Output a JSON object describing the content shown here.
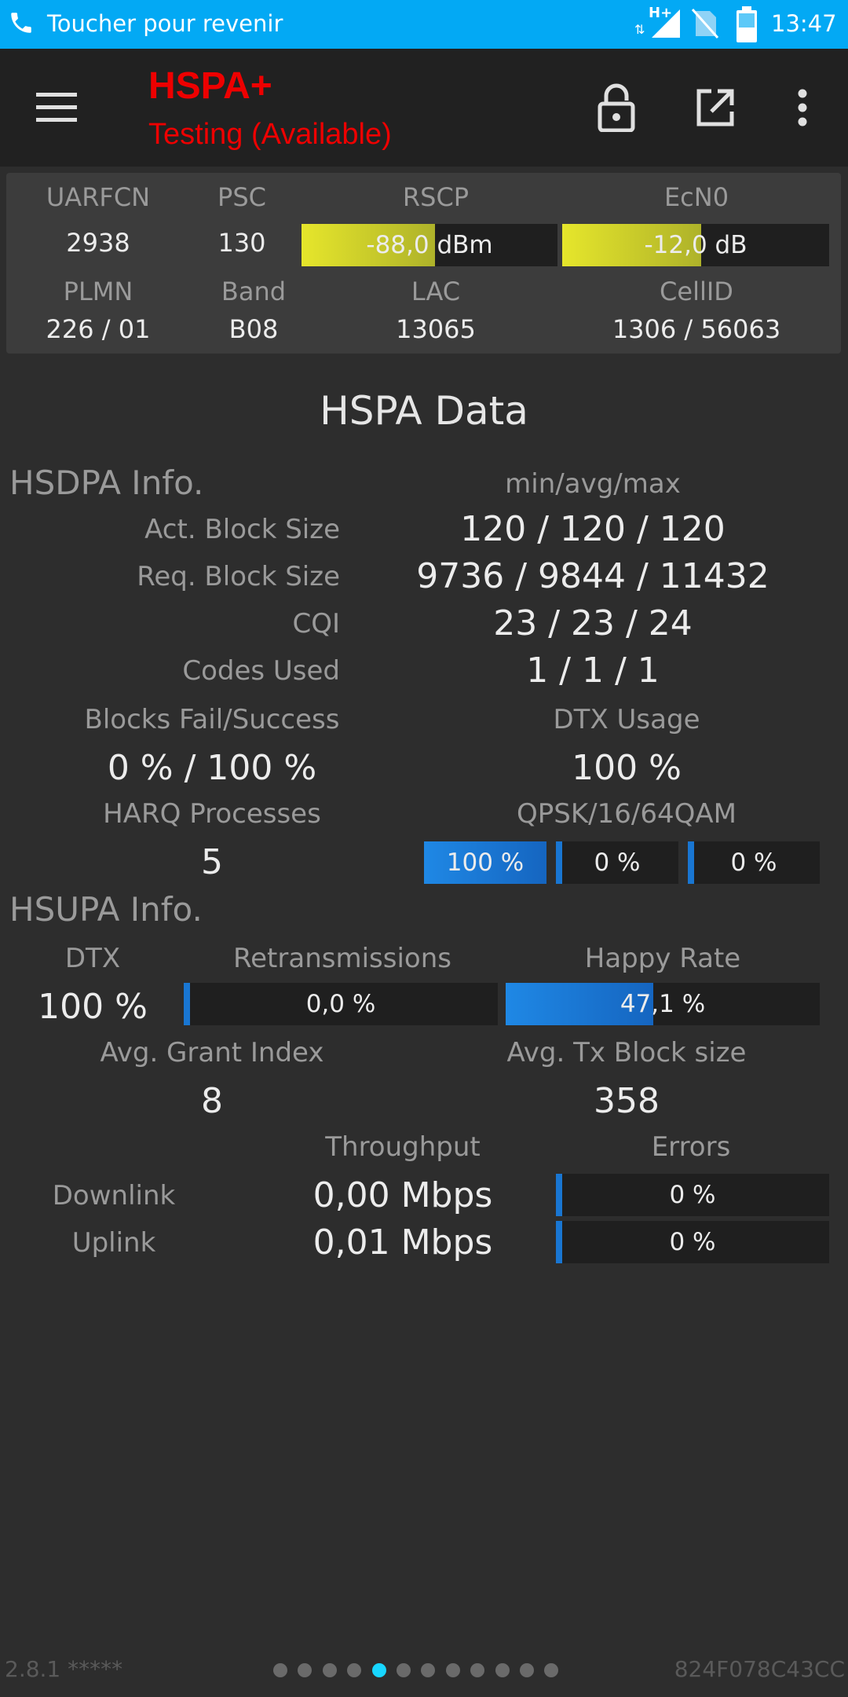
{
  "status_bar": {
    "notice": "Toucher pour revenir",
    "network_badge": "H+",
    "time": "13:47"
  },
  "toolbar": {
    "title": "HSPA+",
    "subtitle": "Testing (Available)",
    "icons": [
      "menu-icon",
      "lock-open-icon",
      "open-external-icon",
      "more-vert-icon"
    ]
  },
  "cell": {
    "labels": {
      "uarfcn": "UARFCN",
      "psc": "PSC",
      "rscp": "RSCP",
      "ecn0": "EcN0",
      "plmn": "PLMN",
      "band": "Band",
      "lac": "LAC",
      "cellid": "CellID"
    },
    "uarfcn": "2938",
    "psc": "130",
    "rscp": "-88,0 dBm",
    "rscp_level": 0.52,
    "ecn0": "-12,0 dB",
    "ecn0_level": 0.52,
    "plmn": "226 / 01",
    "band": "B08",
    "lac": "13065",
    "cellid": "1306 / 56063"
  },
  "section_title": "HSPA Data",
  "hsdpa": {
    "heading": "HSDPA Info.",
    "col_header": "min/avg/max",
    "rows": [
      {
        "label": "Act. Block Size",
        "value": "120 / 120 / 120"
      },
      {
        "label": "Req. Block Size",
        "value": "9736 / 9844 / 11432"
      },
      {
        "label": "CQI",
        "value": "23 / 23 / 24"
      },
      {
        "label": "Codes Used",
        "value": "1 / 1 / 1"
      }
    ],
    "blocks_label": "Blocks Fail/Success",
    "blocks_value": "0 % / 100 %",
    "dtx_label": "DTX Usage",
    "dtx_value": "100 %",
    "harq_label": "HARQ Processes",
    "harq_value": "5",
    "qam_label": "QPSK/16/64QAM",
    "qam": [
      {
        "text": "100 %",
        "level": 1.0
      },
      {
        "text": "0 %",
        "level": 0.0
      },
      {
        "text": "0 %",
        "level": 0.0
      }
    ]
  },
  "hsupa": {
    "heading": "HSUPA Info.",
    "dtx_label": "DTX",
    "dtx_value": "100 %",
    "retrans_label": "Retransmissions",
    "retrans_value": "0,0 %",
    "retrans_level": 0.0,
    "happy_label": "Happy Rate",
    "happy_value": "47,1 %",
    "happy_level": 0.471,
    "grant_label": "Avg. Grant Index",
    "grant_value": "8",
    "txblock_label": "Avg. Tx Block size",
    "txblock_value": "358"
  },
  "throughput": {
    "throughput_label": "Throughput",
    "errors_label": "Errors",
    "downlink_label": "Downlink",
    "downlink_value": "0,00 Mbps",
    "downlink_errors": "0 %",
    "downlink_errors_level": 0.0,
    "uplink_label": "Uplink",
    "uplink_value": "0,01 Mbps",
    "uplink_errors": "0 %",
    "uplink_errors_level": 0.0
  },
  "footer": {
    "version": "2.8.1 *****",
    "device_id": "824F078C43CC",
    "page_count": 12,
    "active_page": 4
  },
  "colors": {
    "status_bar": "#03a9f4",
    "title_red": "#ee0000",
    "bar_yellow": "#e6e62b",
    "bar_blue": "#1f88e5",
    "active_dot": "#18d6ff"
  }
}
